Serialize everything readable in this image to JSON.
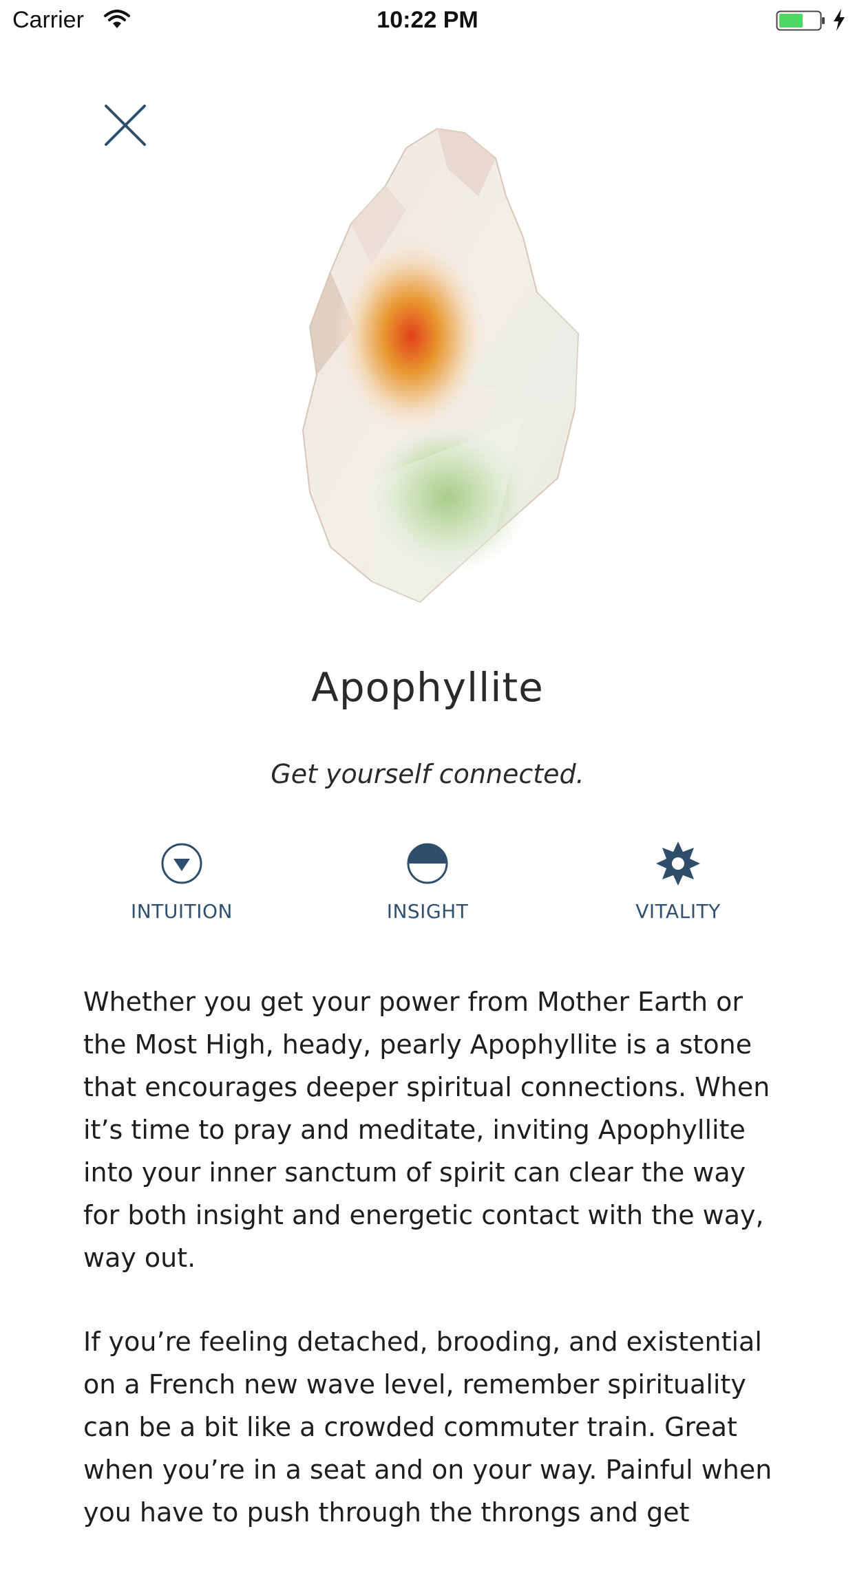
{
  "status_bar": {
    "carrier": "Carrier",
    "time": "10:22 PM",
    "battery_color": "#4cd964"
  },
  "icons": {
    "close": "close-icon",
    "wifi": "wifi-icon",
    "battery": "battery-icon",
    "charging": "bolt-icon"
  },
  "stone": {
    "name": "Apophyllite",
    "tagline": "Get yourself connected."
  },
  "attributes": [
    {
      "label": "INTUITION",
      "icon": "triangle-circle-icon"
    },
    {
      "label": "INSIGHT",
      "icon": "half-circle-icon"
    },
    {
      "label": "VITALITY",
      "icon": "sun-star-icon"
    }
  ],
  "description": {
    "paragraphs": [
      "Whether you get your power from Mother Earth or the Most High, heady, pearly Apophyllite is a stone that encourages deeper spiritual connections. When it’s time to pray and meditate, inviting Apophyllite into your inner sanctum of spirit can clear the way for both insight and energetic contact with the way, way out.",
      "If you’re feeling detached, brooding, and existential on a French new wave level, remember spirituality can be a bit like a crowded commuter train. Great when you’re in a seat and on your way. Painful when you have to push through the throngs and get"
    ]
  },
  "colors": {
    "accent": "#2f4e6b",
    "text": "#2a2a2a"
  }
}
